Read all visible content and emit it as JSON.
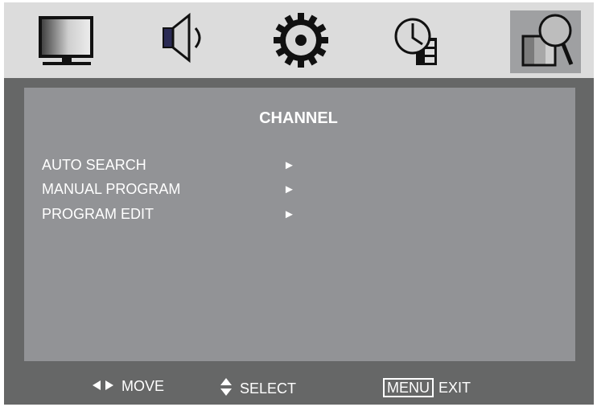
{
  "icons": [
    {
      "name": "picture-icon",
      "selected": false
    },
    {
      "name": "sound-icon",
      "selected": false
    },
    {
      "name": "setup-gear-icon",
      "selected": false
    },
    {
      "name": "time-icon",
      "selected": false
    },
    {
      "name": "channel-search-icon",
      "selected": true
    }
  ],
  "menu": {
    "title": "CHANNEL",
    "items": [
      {
        "label": "AUTO SEARCH",
        "arrow": "►"
      },
      {
        "label": "MANUAL PROGRAM",
        "arrow": "►"
      },
      {
        "label": "PROGRAM EDIT",
        "arrow": "►"
      }
    ]
  },
  "footer": {
    "move_label": "MOVE",
    "select_label": "SELECT",
    "menu_key": "MENU",
    "exit_label": "EXIT"
  },
  "colors": {
    "frame": "#666767",
    "icon_bar": "#dcdcdc",
    "selected_tile": "#9fa0a2",
    "panel": "#929396",
    "text": "#ffffff"
  }
}
